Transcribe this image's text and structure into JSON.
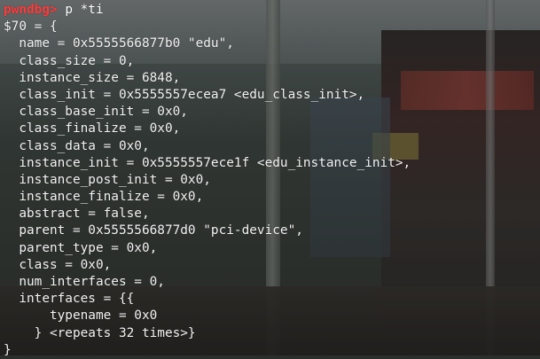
{
  "terminal": {
    "prompt": "pwndbg>",
    "command": " p *ti",
    "lines": [
      "$70 = {",
      "  name = 0x5555566877b0 \"edu\",",
      "  class_size = 0,",
      "  instance_size = 6848,",
      "  class_init = 0x5555557ecea7 <edu_class_init>,",
      "  class_base_init = 0x0,",
      "  class_finalize = 0x0,",
      "  class_data = 0x0,",
      "  instance_init = 0x5555557ece1f <edu_instance_init>,",
      "  instance_post_init = 0x0,",
      "  instance_finalize = 0x0,",
      "  abstract = false,",
      "  parent = 0x5555566877d0 \"pci-device\",",
      "  parent_type = 0x0,",
      "  class = 0x0,",
      "  num_interfaces = 0,",
      "  interfaces = {{",
      "      typename = 0x0",
      "    } <repeats 32 times>}",
      "}"
    ]
  },
  "colors": {
    "prompt": "#ff3b3b",
    "text": "#f3f3f3"
  }
}
